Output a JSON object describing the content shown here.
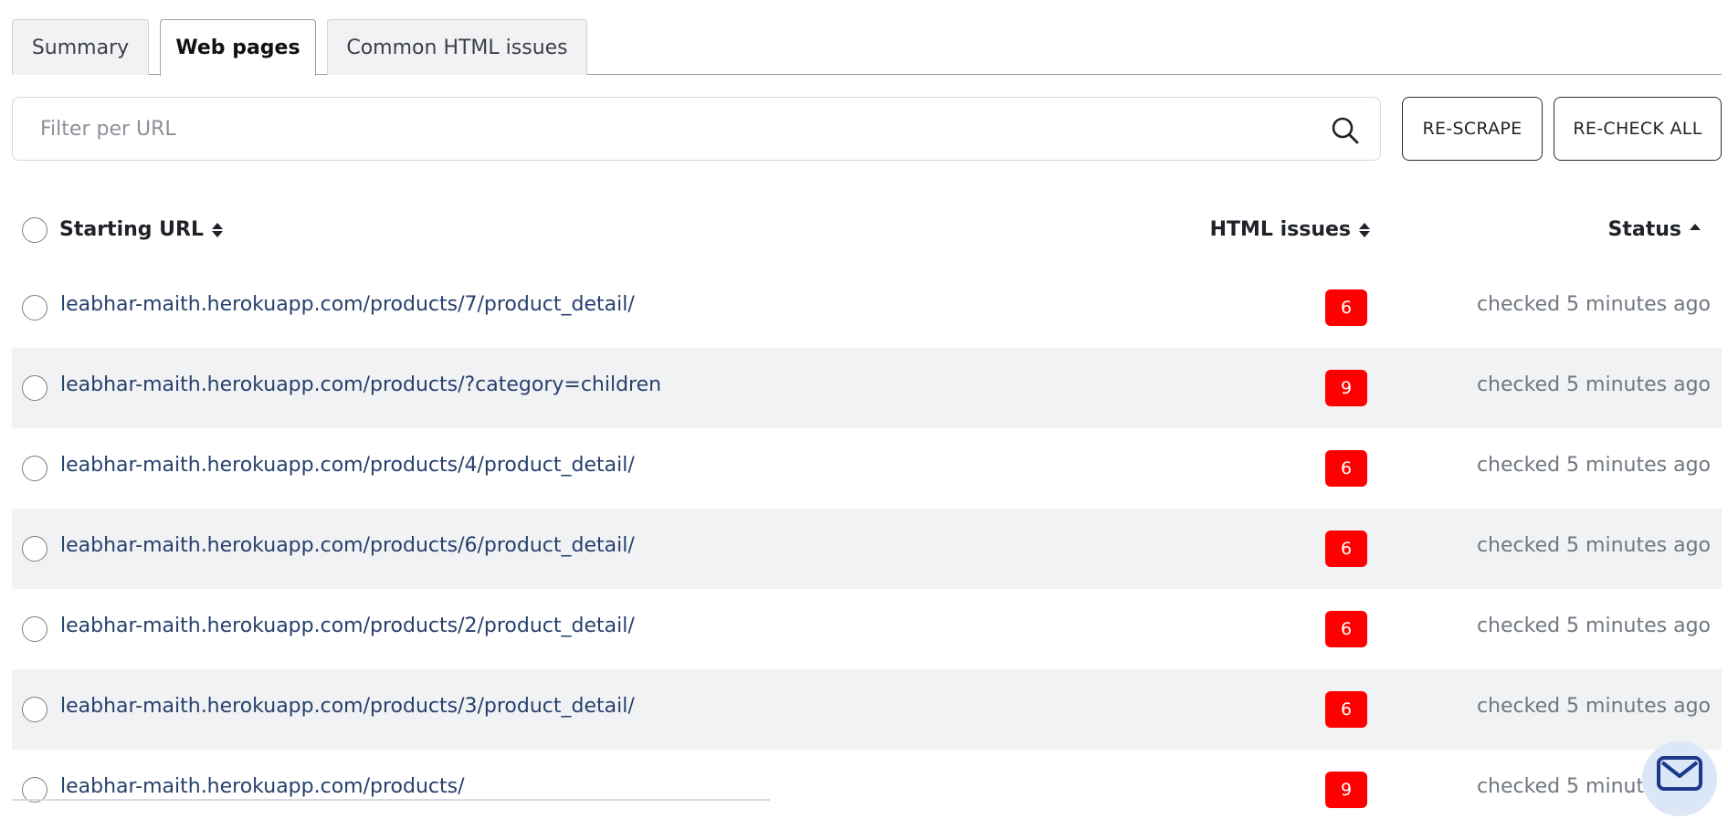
{
  "tabs": [
    {
      "label": "Summary",
      "active": false
    },
    {
      "label": "Web pages",
      "active": true
    },
    {
      "label": "Common HTML issues",
      "active": false
    }
  ],
  "filter": {
    "placeholder": "Filter per URL",
    "value": ""
  },
  "actions": {
    "rescrape_label": "RE-SCRAPE",
    "recheck_label": "RE-CHECK ALL"
  },
  "table": {
    "headers": {
      "url": "Starting URL",
      "issues": "HTML issues",
      "status": "Status"
    },
    "rows": [
      {
        "url": "leabhar-maith.herokuapp.com/products/7/product_detail/",
        "issues": "6",
        "status": "checked 5 minutes ago"
      },
      {
        "url": "leabhar-maith.herokuapp.com/products/?category=children",
        "issues": "9",
        "status": "checked 5 minutes ago"
      },
      {
        "url": "leabhar-maith.herokuapp.com/products/4/product_detail/",
        "issues": "6",
        "status": "checked 5 minutes ago"
      },
      {
        "url": "leabhar-maith.herokuapp.com/products/6/product_detail/",
        "issues": "6",
        "status": "checked 5 minutes ago"
      },
      {
        "url": "leabhar-maith.herokuapp.com/products/2/product_detail/",
        "issues": "6",
        "status": "checked 5 minutes ago"
      },
      {
        "url": "leabhar-maith.herokuapp.com/products/3/product_detail/",
        "issues": "6",
        "status": "checked 5 minutes ago"
      },
      {
        "url": "leabhar-maith.herokuapp.com/products/",
        "issues": "9",
        "status": "checked 5 minutes ago"
      }
    ]
  },
  "colors": {
    "issue_badge": "#ff0000",
    "link": "#27406e",
    "row_alt": "#f1f2f4"
  },
  "icons": {
    "search": "search-icon",
    "sort": "sort-icon",
    "mail": "mail-icon"
  }
}
